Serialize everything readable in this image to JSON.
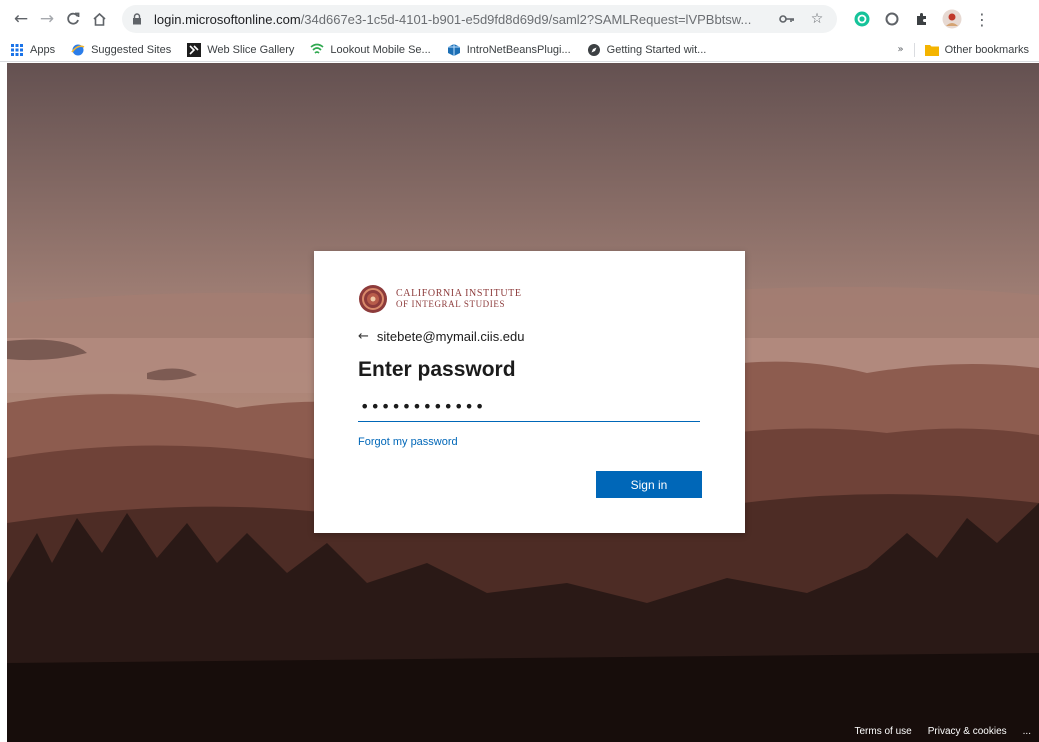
{
  "browser": {
    "url_domain": "login.microsoftonline.com",
    "url_path": "/34d667e3-1c5d-4101-b901-e5d9fd8d69d9/saml2?SAMLRequest=lVPBbtsw..."
  },
  "bookmarks": {
    "apps": "Apps",
    "items": [
      "Suggested Sites",
      "Web Slice Gallery",
      "Lookout Mobile Se...",
      "IntroNetBeansPlugi...",
      "Getting Started wit..."
    ],
    "overflow": "»",
    "other": "Other bookmarks"
  },
  "login": {
    "logo_line1": "California Institute",
    "logo_line2": "of Integral Studies",
    "identity": "sitebete@mymail.ciis.edu",
    "title": "Enter password",
    "password_value": "••••••••••••",
    "forgot_link": "Forgot my password",
    "sign_in": "Sign in"
  },
  "footer": {
    "terms": "Terms of use",
    "privacy": "Privacy & cookies",
    "more": "..."
  },
  "icons": {
    "back": "back-arrow-icon",
    "forward": "forward-arrow-icon",
    "reload": "reload-icon",
    "home": "home-icon",
    "lock": "lock-icon",
    "key": "key-icon",
    "star": "star-icon"
  },
  "colors": {
    "accent": "#0067b8",
    "logo": "#8d3b3b"
  }
}
